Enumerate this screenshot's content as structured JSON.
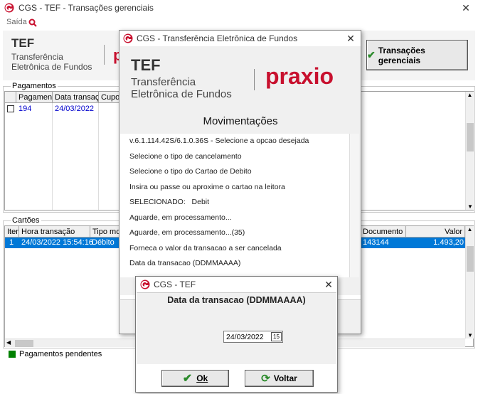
{
  "main_window": {
    "title": "CGS - TEF - Transações gerenciais",
    "menu_exit": "Saída",
    "banner_tef": "TEF",
    "banner_sub1": "Transferência",
    "banner_sub2": "Eletrônica de Fundos",
    "trans_button": "Transações gerenciais",
    "payments_group": "Pagamentos",
    "payments_columns": [
      "Pagamento",
      "Data transação",
      "Cupom"
    ],
    "payments_row": {
      "pagamento": "194",
      "data": "24/03/2022"
    },
    "cards_group": "Cartões",
    "cards_columns": [
      "Item",
      "Hora transação",
      "Tipo movto",
      "Documento",
      "Valor"
    ],
    "cards_row": {
      "item": "1",
      "hora": "24/03/2022 15:54:16",
      "tipo": "Débito",
      "documento": "143144",
      "valor": "1.493,20"
    },
    "legend_pending": "Pagamentos pendentes",
    "colors": {
      "select_blue": "#0078d7",
      "link_blue": "#0000cc",
      "green": "#008000",
      "praxio_red": "#c8102e"
    }
  },
  "tef_dialog": {
    "title": "CGS - Transferência Eletrônica de Fundos",
    "logo_tef": "TEF",
    "logo_sub1": "Transferência",
    "logo_sub2": "Eletrônica de Fundos",
    "brand": "praxio",
    "heading": "Movimentações",
    "log": [
      "v.6.1.114.42S/6.1.0.36S - Selecione a opcao desejada",
      "Selecione o tipo de cancelamento",
      "Selecione o tipo do Cartao de Debito",
      "Insira ou passe ou aproxime o cartao na leitora",
      "SELECIONADO:   Debit",
      "Aguarde, em processamento...",
      "Aguarde, em processamento...(35)",
      "Forneca o valor da transacao a ser cancelada",
      "Data da transacao (DDMMAAAA)"
    ]
  },
  "date_dialog": {
    "title": "CGS - TEF",
    "prompt": "Data da transacao (DDMMAAAA)",
    "date_value": "24/03/2022",
    "calendar_label": "15",
    "ok_label": "Ok",
    "back_label": "Voltar"
  }
}
